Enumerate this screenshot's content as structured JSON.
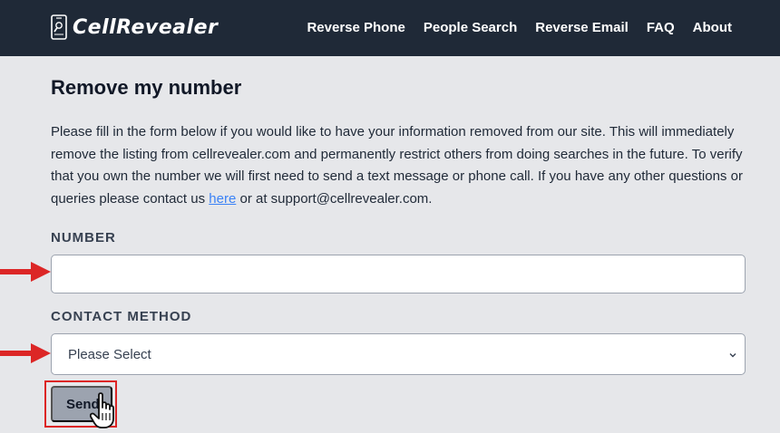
{
  "brand": {
    "name": "CellRevealer",
    "icon": "phone-search-icon"
  },
  "nav": {
    "items": [
      "Reverse Phone",
      "People Search",
      "Reverse Email",
      "FAQ",
      "About"
    ]
  },
  "main": {
    "title": "Remove my number",
    "description": {
      "before_link": "Please fill in the form below if you would like to have your information removed from our site. This will immediately remove the listing from cellrevealer.com and permanently restrict others from doing searches in the future. To verify that you own the number we will first need to send a text message or phone call. If you have any other questions or queries please contact us ",
      "link_text": "here",
      "after_link": " or at support@cellrevealer.com."
    }
  },
  "form": {
    "number_label": "NUMBER",
    "number_value": "",
    "contact_label": "CONTACT METHOD",
    "contact_selected": "Please Select",
    "send_label": "Send"
  },
  "colors": {
    "navbar": "#1f2937",
    "background": "#e6e7ea",
    "link": "#3b82f6",
    "annotation": "#dc2626",
    "button": "#9ca3af"
  }
}
